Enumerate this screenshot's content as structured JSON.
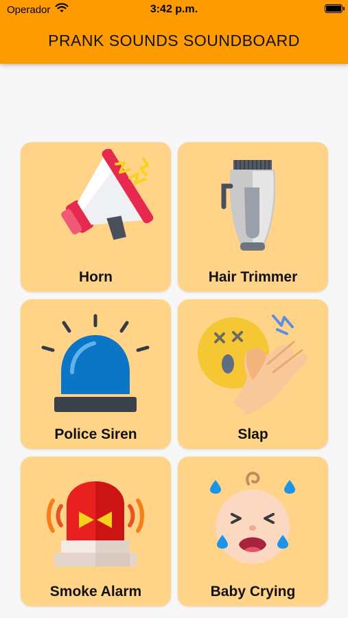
{
  "status_bar": {
    "carrier": "Operador",
    "time": "3:42 p.m."
  },
  "header": {
    "title": "PRANK SOUNDS SOUNDBOARD",
    "color": "#fe9b00"
  },
  "tile_color": "#ffd488",
  "sounds": [
    {
      "label": "Horn",
      "icon": "megaphone-icon"
    },
    {
      "label": "Hair Trimmer",
      "icon": "hair-trimmer-icon"
    },
    {
      "label": "Police Siren",
      "icon": "police-siren-icon"
    },
    {
      "label": "Slap",
      "icon": "slap-icon"
    },
    {
      "label": "Smoke Alarm",
      "icon": "smoke-alarm-icon"
    },
    {
      "label": "Baby Crying",
      "icon": "baby-crying-icon"
    }
  ]
}
